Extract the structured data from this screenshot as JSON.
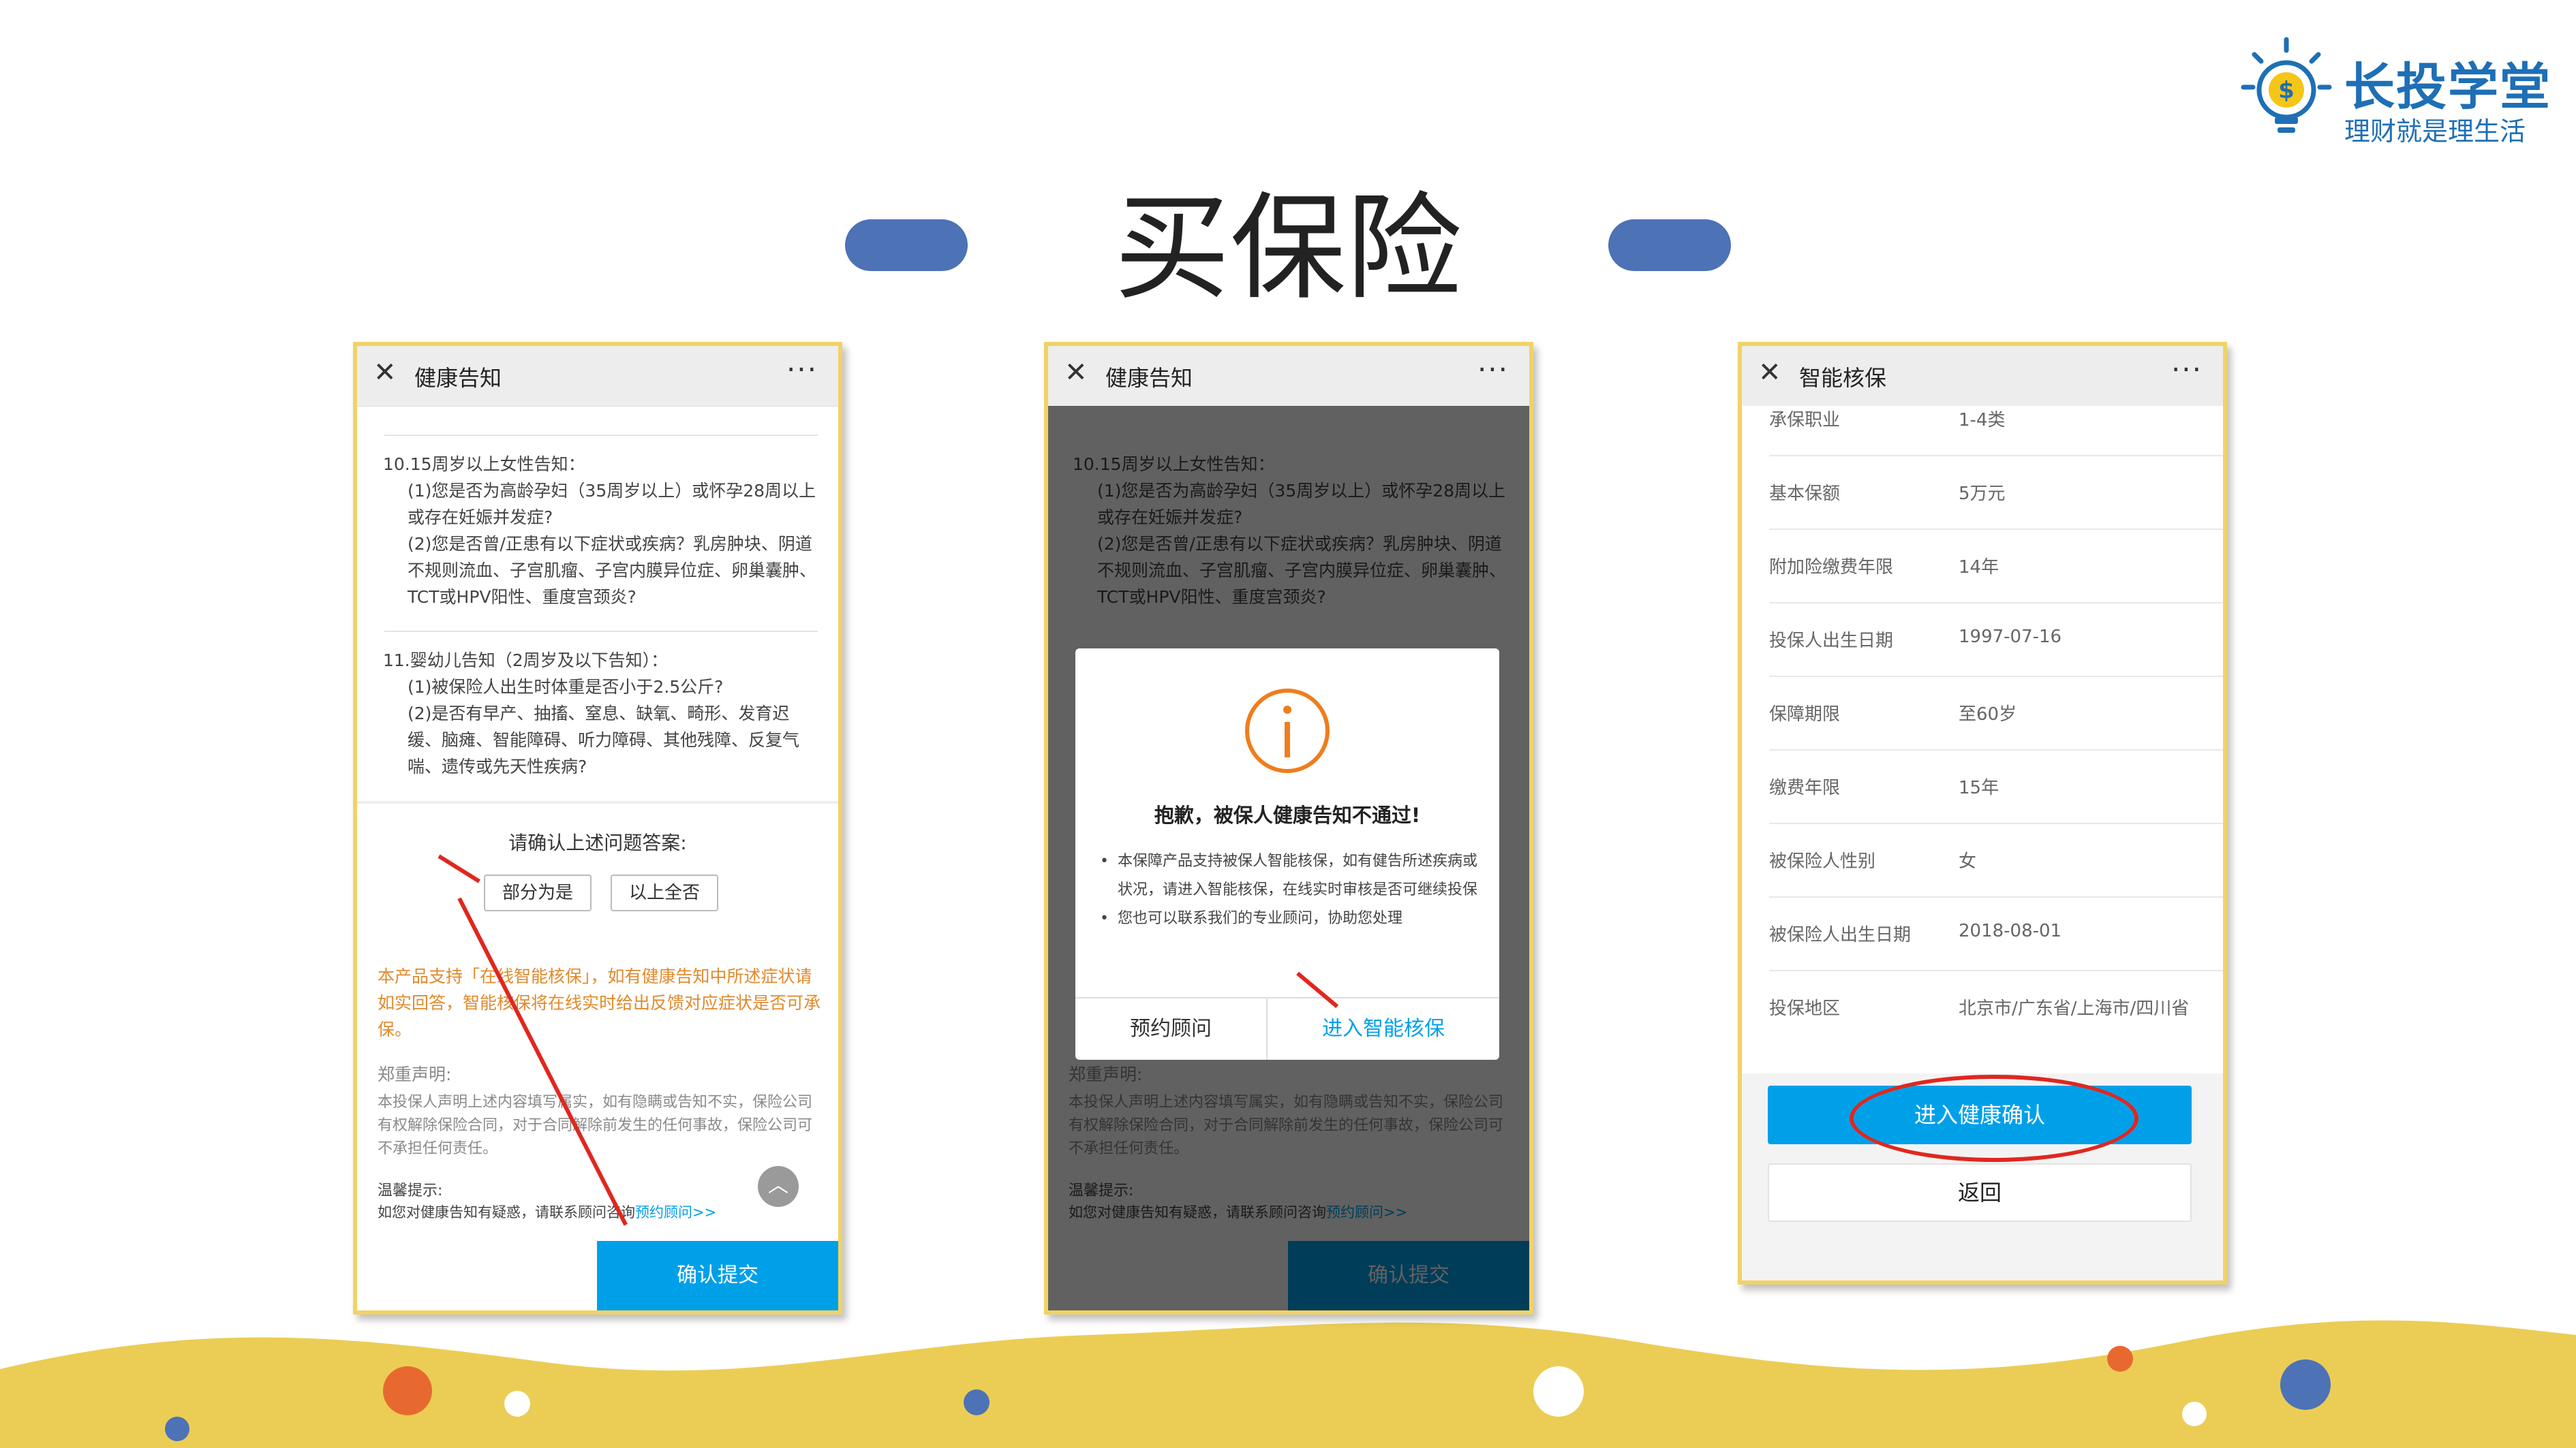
{
  "logo": {
    "name": "长投学堂",
    "slogan": "理财就是理生活"
  },
  "slide_title": "买保险",
  "phone1": {
    "header_title": "健康告知",
    "item10_title": "10.15周岁以上女性告知：",
    "item10_q1": "(1)您是否为高龄孕妇（35周岁以上）或怀孕28周以上或存在妊娠并发症?",
    "item10_q2": "(2)您是否曾/正患有以下症状或疾病？乳房肿块、阴道不规则流血、子宫肌瘤、子宫内膜异位症、卵巢囊肿、TCT或HPV阳性、重度宫颈炎?",
    "item11_title": "11.婴幼儿告知（2周岁及以下告知）：",
    "item11_q1": "(1)被保险人出生时体重是否小于2.5公斤?",
    "item11_q2": "(2)是否有早产、抽搐、窒息、缺氧、畸形、发育迟缓、脑瘫、智能障碍、听力障碍、其他残障、反复气喘、遗传或先天性疾病?",
    "confirm_prompt": "请确认上述问题答案:",
    "option_partial": "部分为是",
    "option_none": "以上全否",
    "notice_orange": "本产品支持「在线智能核保」，如有健康告知中所述症状请如实回答，智能核保将在线实时给出反馈对应症状是否可承保。",
    "declaration_title": "郑重声明:",
    "declaration_text": "本投保人声明上述内容填写属实，如有隐瞒或告知不实，保险公司有权解除保险合同，对于合同解除前发生的任何事故，保险公司可不承担任何责任。",
    "tip_title": "温馨提示:",
    "tip_text": "如您对健康告知有疑惑，请联系顾问咨询",
    "tip_link": "预约顾问>>",
    "submit": "确认提交"
  },
  "phone2": {
    "header_title": "健康告知",
    "dialog_title": "抱歉，被保人健康告知不通过!",
    "dialog_bullet1": "本保障产品支持被保人智能核保，如有健告所述疾病或状况，请进入智能核保，在线实时审核是否可继续投保",
    "dialog_bullet2": "您也可以联系我们的专业顾问，协助您处理",
    "btn_consult": "预约顾问",
    "btn_smart": "进入智能核保"
  },
  "phone3": {
    "header_title": "智能核保",
    "rows": [
      {
        "k": "承保职业",
        "v": "1-4类"
      },
      {
        "k": "基本保额",
        "v": "5万元"
      },
      {
        "k": "附加险缴费年限",
        "v": "14年"
      },
      {
        "k": "投保人出生日期",
        "v": "1997-07-16"
      },
      {
        "k": "保障期限",
        "v": "至60岁"
      },
      {
        "k": "缴费年限",
        "v": "15年"
      },
      {
        "k": "被保险人性别",
        "v": "女"
      },
      {
        "k": "被保险人出生日期",
        "v": "2018-08-01"
      },
      {
        "k": "投保地区",
        "v": "北京市/广东省/上海市/四川省"
      }
    ],
    "btn_health": "进入健康确认",
    "btn_back": "返回"
  },
  "colors": {
    "accent": "#00a0e9",
    "frame": "#f1d266",
    "wave": "#ebcd55",
    "pill": "#4d72b5",
    "orange_text": "#e08a2c",
    "annotation_red": "#e0271f"
  }
}
